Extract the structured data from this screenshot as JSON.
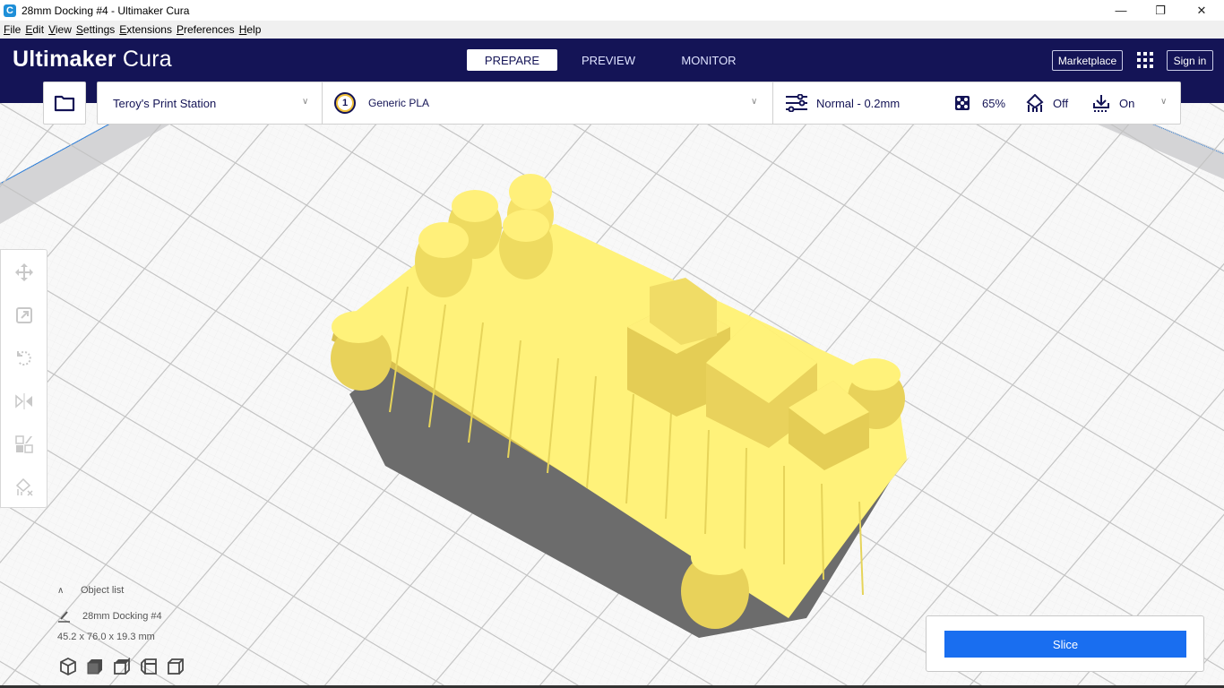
{
  "window": {
    "title": "28mm Docking #4 - Ultimaker Cura",
    "app_icon_glyph": "C",
    "controls": {
      "minimize": "—",
      "maximize": "❐",
      "close": "✕"
    }
  },
  "menu": [
    "File",
    "Edit",
    "View",
    "Settings",
    "Extensions",
    "Preferences",
    "Help"
  ],
  "header": {
    "logo_bold": "Ultimaker",
    "logo_light": "Cura",
    "tabs": [
      {
        "label": "PREPARE",
        "active": true
      },
      {
        "label": "PREVIEW",
        "active": false
      },
      {
        "label": "MONITOR",
        "active": false
      }
    ],
    "marketplace_label": "Marketplace",
    "signin_label": "Sign in"
  },
  "toolbar": {
    "printer": "Teroy's Print Station",
    "extruder_number": "1",
    "material": "Generic PLA",
    "profile": "Normal - 0.2mm",
    "infill": "65%",
    "support": "Off",
    "adhesion": "On"
  },
  "left_tools": [
    {
      "name": "move-tool",
      "icon": "move"
    },
    {
      "name": "scale-tool",
      "icon": "scale"
    },
    {
      "name": "rotate-tool",
      "icon": "rotate"
    },
    {
      "name": "mirror-tool",
      "icon": "mirror"
    },
    {
      "name": "per-model-settings-tool",
      "icon": "per-model"
    },
    {
      "name": "support-blocker-tool",
      "icon": "support-blocker"
    }
  ],
  "object_list": {
    "header": "Object list",
    "object_name": "28mm Docking #4",
    "dimensions": "45.2 x 76.0 x 19.3 mm"
  },
  "view_buttons": [
    "3d-view",
    "front-view",
    "top-view",
    "left-view",
    "right-view"
  ],
  "slice": {
    "label": "Slice"
  },
  "colors": {
    "header_bg": "#141456",
    "model_yellow": "#ffef6e",
    "slice_blue": "#196ef0"
  }
}
